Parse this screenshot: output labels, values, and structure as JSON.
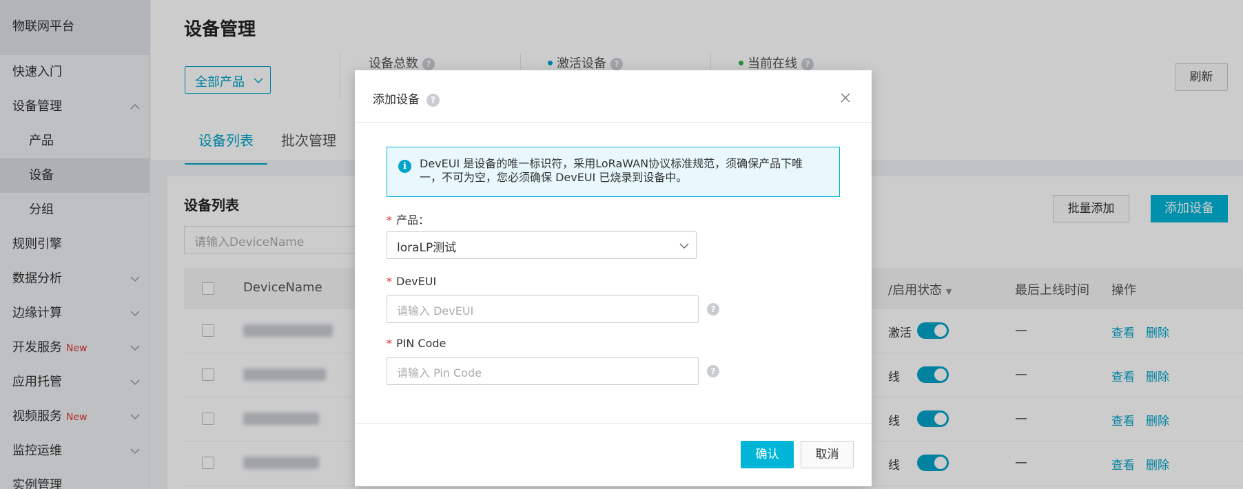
{
  "sidebar": {
    "brand": "物联网平台",
    "items": [
      {
        "label": "快速入门"
      },
      {
        "label": "设备管理"
      },
      {
        "label": "产品"
      },
      {
        "label": "设备"
      },
      {
        "label": "分组"
      },
      {
        "label": "规则引擎"
      },
      {
        "label": "数据分析"
      },
      {
        "label": "边缘计算"
      },
      {
        "label": "开发服务",
        "badge": "New"
      },
      {
        "label": "应用托管"
      },
      {
        "label": "视频服务",
        "badge": "New"
      },
      {
        "label": "监控运维"
      },
      {
        "label": "实例管理"
      }
    ]
  },
  "header": {
    "title": "设备管理",
    "product_filter": "全部产品",
    "stats": {
      "total_label": "设备总数",
      "active_label": "激活设备",
      "online_label": "当前在线"
    },
    "refresh_label": "刷新",
    "tabs": [
      "设备列表",
      "批次管理"
    ]
  },
  "device_list": {
    "title": "设备列表",
    "search_placeholder": "请输入DeviceName",
    "batch_add_label": "批量添加",
    "add_label": "添加设备",
    "columns": {
      "device_name": "DeviceName",
      "status": "/启用状态",
      "last_online": "最后上线时间",
      "actions": "操作"
    },
    "rows": [
      {
        "state": "激活",
        "last_online": "—",
        "view": "查看",
        "delete": "删除"
      },
      {
        "state": "线",
        "last_online": "—",
        "view": "查看",
        "delete": "删除"
      },
      {
        "state": "线",
        "last_online": "—",
        "view": "查看",
        "delete": "删除"
      },
      {
        "state": "线",
        "last_online": "—",
        "view": "查看",
        "delete": "删除"
      }
    ]
  },
  "modal": {
    "title": "添加设备",
    "info": "DevEUI 是设备的唯一标识符，采用LoRaWAN协议标准规范，须确保产品下唯一，不可为空，您必须确保 DevEUI 已烧录到设备中。",
    "product_label": "产品：",
    "product_value": "loraLP测试",
    "deveui_label": "DevEUI",
    "deveui_placeholder": "请输入 DevEUI",
    "pin_label": "PIN Code",
    "pin_placeholder": "请输入 Pin Code",
    "confirm_label": "确认",
    "cancel_label": "取消"
  },
  "colors": {
    "accent": "#00a3c9",
    "primary_button": "#00b5d8",
    "required": "#e0302c",
    "info_bg": "#e8f8fc"
  }
}
